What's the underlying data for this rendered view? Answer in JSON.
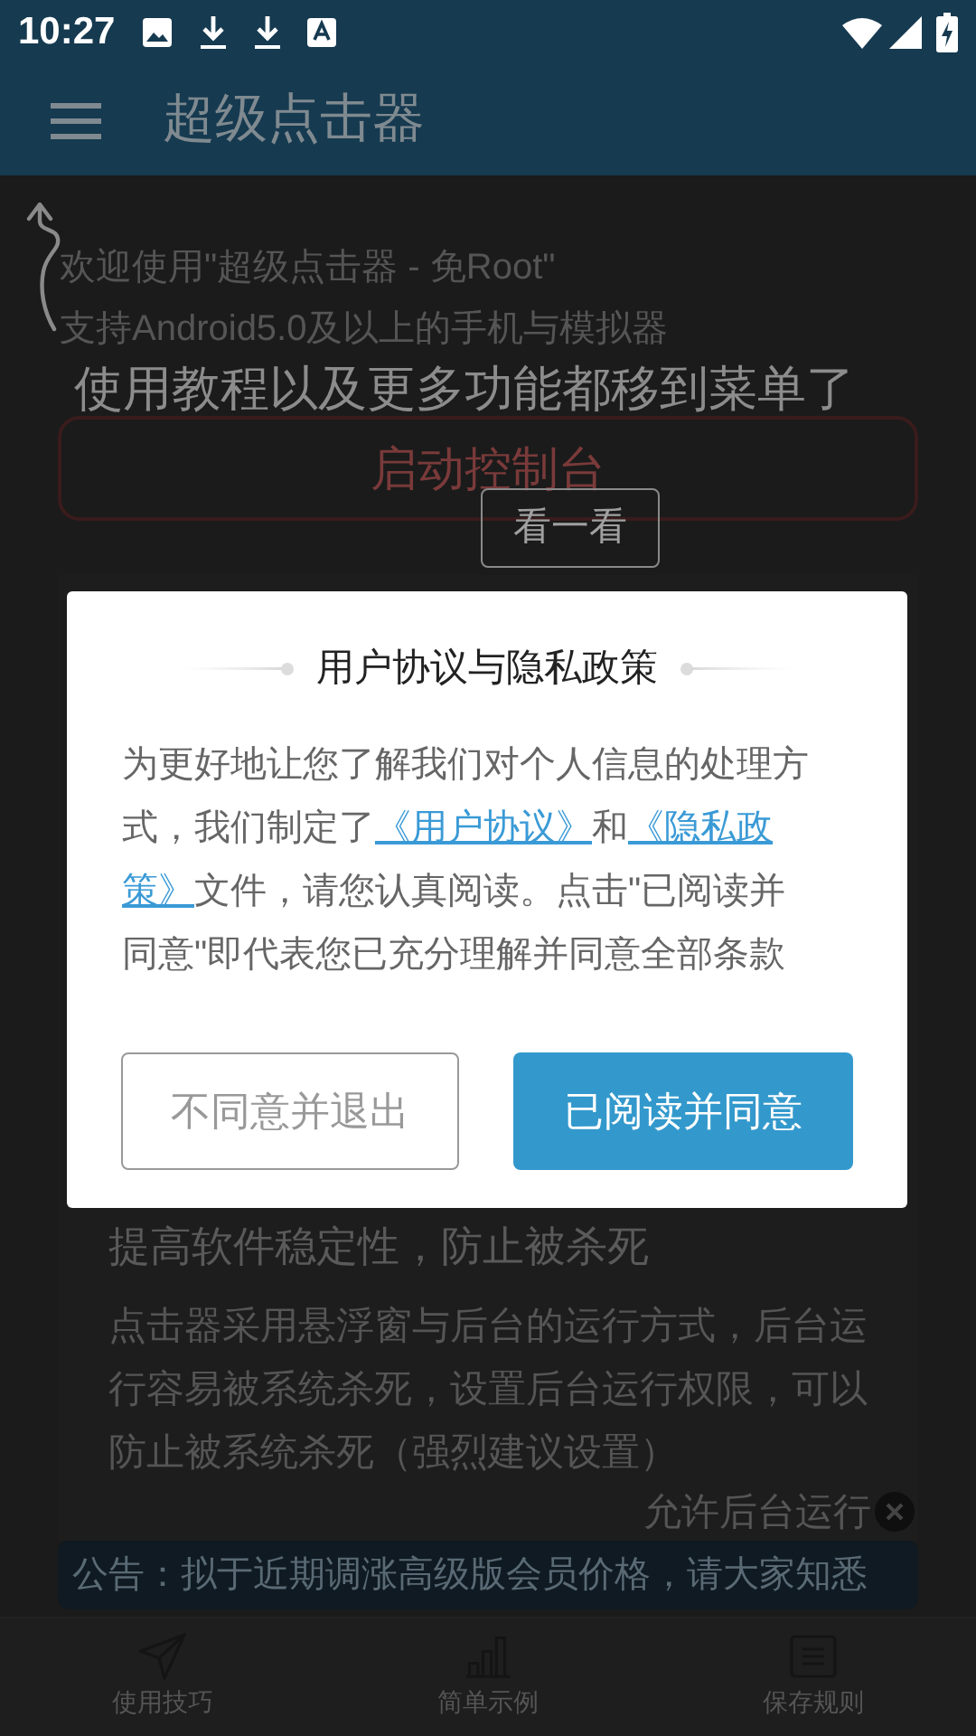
{
  "status_bar": {
    "time": "10:27"
  },
  "app_bar": {
    "title": "超级点击器"
  },
  "welcome_lines": [
    "欢迎使用\"超级点击器 - 免Root\"",
    "支持Android5.0及以上的手机与模拟器"
  ],
  "start_button": {
    "label": "启动控制台"
  },
  "card": {
    "title": "提高软件稳定性，防止被杀死",
    "body": "点击器采用悬浮窗与后台的运行方式，后台运行容易被系统杀死，设置后台运行权限，可以防止被系统杀死（强烈建议设置）",
    "action": "允许后台运行"
  },
  "notice": {
    "text": "公告：拟于近期调涨高级版会员价格，请大家知悉"
  },
  "bottom_nav": [
    {
      "label": "使用技巧",
      "kind": "plane"
    },
    {
      "label": "简单示例",
      "kind": "chart"
    },
    {
      "label": "保存规则",
      "kind": "list"
    }
  ],
  "tutorial": {
    "hint": "使用教程以及更多功能都移到菜单了",
    "button": "看一看"
  },
  "dialog": {
    "title": "用户协议与隐私政策",
    "body_lines": [
      [
        {
          "kind": "text",
          "text": "为更好地让您了解我们对个人信息的处理方"
        }
      ],
      [
        {
          "kind": "text",
          "text": "式，我们制定了"
        },
        {
          "kind": "link",
          "text": "《用户协议》"
        },
        {
          "kind": "text",
          "text": "和"
        },
        {
          "kind": "link",
          "text": "《隐私政"
        }
      ],
      [
        {
          "kind": "link",
          "text": "策》"
        },
        {
          "kind": "text",
          "text": "文件，请您认真阅读。点击\"已阅读并"
        }
      ],
      [
        {
          "kind": "text",
          "text": "同意\"即代表您已充分理解并同意全部条款"
        }
      ]
    ],
    "buttons": [
      {
        "label": "不同意并退出",
        "kind": "secondary"
      },
      {
        "label": "已阅读并同意",
        "kind": "primary"
      }
    ]
  }
}
